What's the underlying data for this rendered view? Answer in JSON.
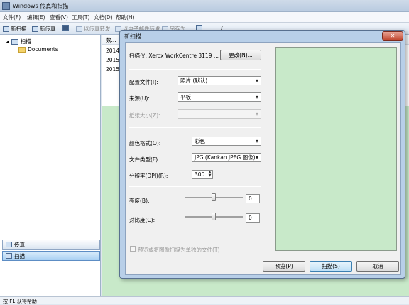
{
  "window": {
    "title": "Windows 传真和扫描"
  },
  "menu": [
    "文件(F)",
    "编辑(E)",
    "查看(V)",
    "工具(T)",
    "文档(D)",
    "帮助(H)"
  ],
  "toolbar": {
    "new_scan": "新扫描",
    "new_fax": "新传真",
    "fax_forward": "以传真转发",
    "email_forward": "以电子邮件转发",
    "save_as": "另存为",
    "help_glyph": "?"
  },
  "nav": {
    "root": "扫描",
    "child": "Documents",
    "fax_button": "传真",
    "scan_button": "扫描"
  },
  "list": {
    "header": "数...",
    "rows": [
      "2014/",
      "2015/",
      "2015/"
    ]
  },
  "status": "按 F1 获得帮助",
  "dialog": {
    "title": "新扫描",
    "close_glyph": "✕",
    "scanner_label": "扫描仪: Xerox WorkCentre 3119 ...",
    "change_button": "更改(N)...",
    "profile_label": "配置文件(I):",
    "profile_value": "照片 (默认)",
    "source_label": "来源(U):",
    "source_value": "平板",
    "paper_label": "纸张大小(Z):",
    "paper_value": "",
    "color_label": "颜色格式(O):",
    "color_value": "彩色",
    "filetype_label": "文件类型(F):",
    "filetype_value": "JPG (Kankan JPEG 图像)",
    "dpi_label": "分辨率(DPI)(R):",
    "dpi_value": "300",
    "brightness_label": "亮度(B):",
    "brightness_value": "0",
    "brightness_level": 0.5,
    "contrast_label": "对比度(C):",
    "contrast_value": "0",
    "contrast_level": 0.5,
    "separate_files_label": "预览或将图像扫描为单独的文件(T)",
    "preview_button": "预览(P)",
    "scan_button": "扫描(S)",
    "cancel_button": "取消"
  },
  "colors": {
    "preview": "#c8e9c9",
    "title_gradient": "#b9cbe0",
    "close": "#c24a32"
  }
}
